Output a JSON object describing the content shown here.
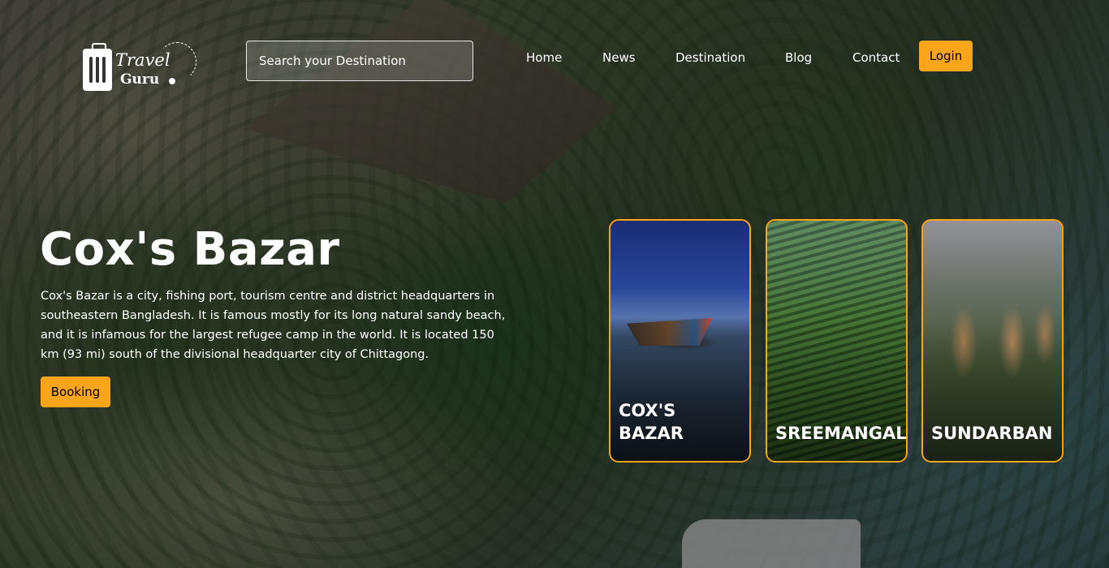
{
  "logo": {
    "line1": "Travel",
    "line2": "Guru"
  },
  "search": {
    "placeholder": "Search your Destination"
  },
  "nav": {
    "items": [
      {
        "label": "Home"
      },
      {
        "label": "News"
      },
      {
        "label": "Destination"
      },
      {
        "label": "Blog"
      },
      {
        "label": "Contact"
      }
    ],
    "login_label": "Login"
  },
  "hero": {
    "title": "Cox's Bazar",
    "description": "Cox's Bazar is a city, fishing port, tourism centre and district headquarters in southeastern Bangladesh. It is famous mostly for its long natural sandy beach, and it is infamous for the largest refugee camp in the world. It is located 150 km (93 mi) south of the divisional headquarter city of Chittagong.",
    "booking_label": "Booking"
  },
  "cards": [
    {
      "label": "COX'S BAZAR"
    },
    {
      "label": "SREEMANGAL"
    },
    {
      "label": "SUNDARBAN"
    }
  ],
  "colors": {
    "accent": "#f9a51a"
  }
}
